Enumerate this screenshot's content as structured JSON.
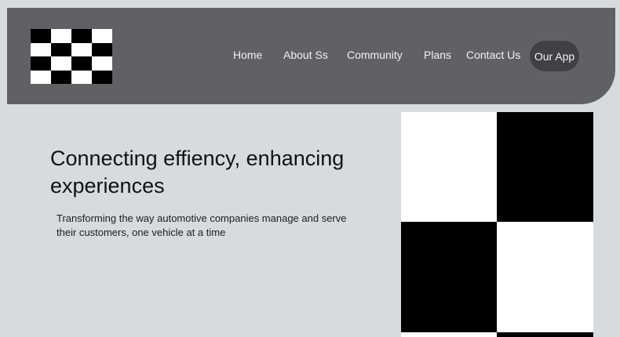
{
  "header": {
    "logo_icon": "checkered-flag-logo",
    "nav": [
      {
        "label": "Home"
      },
      {
        "label": "About Ss"
      },
      {
        "label": "Community"
      },
      {
        "label": "Plans"
      },
      {
        "label": "Contact Us"
      }
    ],
    "cta_label": "Our App"
  },
  "hero": {
    "title": "Connecting effiency, enhancing experiences",
    "subtitle": "Transforming the way automotive companies manage and serve their customers, one vehicle at a time"
  },
  "image": {
    "pattern_icon": "checkered-pattern-image"
  },
  "colors": {
    "background": "#d7dbdf",
    "header": "#5f6165",
    "button": "#3f4144"
  }
}
